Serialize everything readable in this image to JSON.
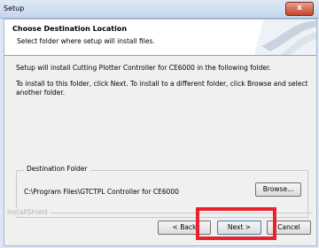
{
  "window": {
    "title": "Setup",
    "close_label": "x"
  },
  "header": {
    "title": "Choose Destination Location",
    "subtitle": "Select folder where setup will install files."
  },
  "content": {
    "intro_line1": "Setup will install Cutting Plotter Controller for CE6000 in the following folder.",
    "intro_line2": "To install to this folder, click Next. To install to a different folder, click Browse and select another folder."
  },
  "destination": {
    "group_label": "Destination Folder",
    "path": "C:\\Program Files\\GTCTPL Controller for CE6000",
    "browse_label": "Browse..."
  },
  "footer": {
    "brand": "InstallShield",
    "back_label": "< Back",
    "next_label": "Next >",
    "cancel_label": "Cancel"
  },
  "colors": {
    "highlight": "#e8232f",
    "close_button": "#c4442b"
  }
}
